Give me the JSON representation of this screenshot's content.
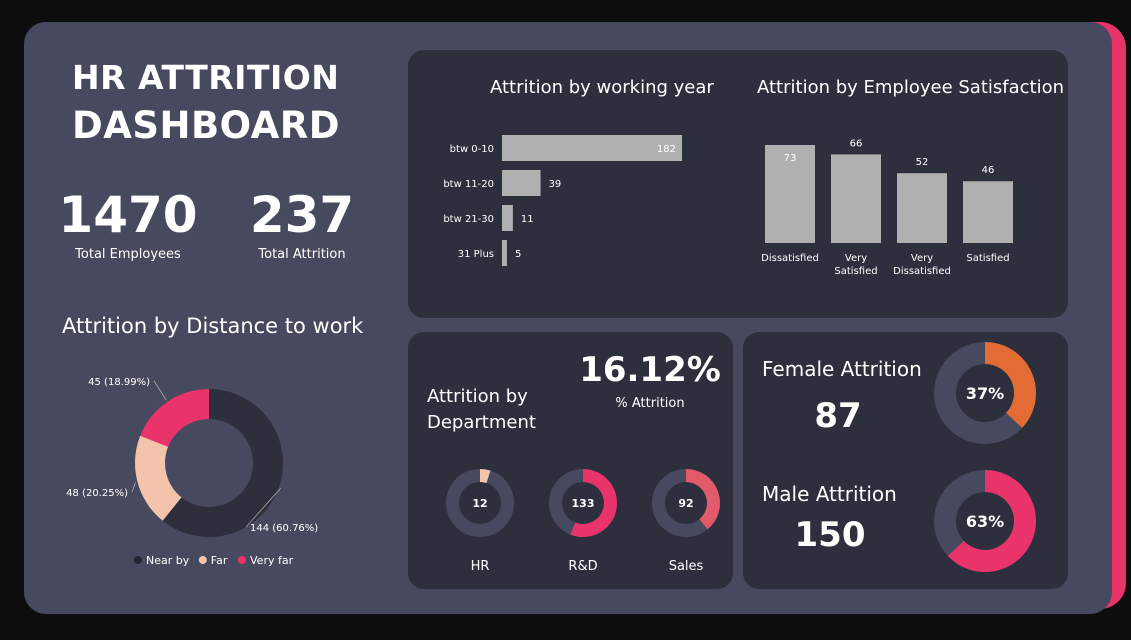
{
  "header": {
    "title_line1": "HR ATTRITION",
    "title_line2": "DASHBOARD"
  },
  "kpis": {
    "total_employees": {
      "value": "1470",
      "label": "Total Employees"
    },
    "total_attrition": {
      "value": "237",
      "label": "Total Attrition"
    }
  },
  "colors": {
    "accent": "#e8336b",
    "panel": "#474a5e",
    "card": "#2e2f3d",
    "bar": "#b0b0b0",
    "near": "#2e2f3d",
    "far": "#f4c3ac",
    "very_far": "#e8336b",
    "female": "#e36c35",
    "track": "#474a5e"
  },
  "department": {
    "title_line1": "Attrition by",
    "title_line2": "Department",
    "percent_value": "16.12%",
    "percent_label": "% Attrition"
  },
  "gender": {
    "female_label": "Female Attrition",
    "female_value": "87",
    "female_pct": "37%",
    "male_label": "Male Attrition",
    "male_value": "150",
    "male_pct": "63%"
  },
  "chart_data": [
    {
      "id": "working_year",
      "type": "bar",
      "orientation": "horizontal",
      "title": "Attrition by working year",
      "categories": [
        "btw 0-10",
        "btw 11-20",
        "btw 21-30",
        "31 Plus"
      ],
      "values": [
        182,
        39,
        11,
        5
      ],
      "data_labels": [
        "182",
        "39",
        "11",
        "5"
      ],
      "xlim": [
        0,
        182
      ]
    },
    {
      "id": "satisfaction",
      "type": "bar",
      "title": "Attrition by Employee Satisfaction",
      "categories": [
        "Dissatisfied",
        "Very Satisfied",
        "Very Dissatisfied",
        "Satisfied"
      ],
      "category_lines": [
        [
          "Dissatisfied"
        ],
        [
          "Very",
          "Satisfied"
        ],
        [
          "Very",
          "Dissatisfied"
        ],
        [
          "Satisfied"
        ]
      ],
      "values": [
        73,
        66,
        52,
        46
      ],
      "data_labels": [
        "73",
        "66",
        "52",
        "46"
      ],
      "ylim": [
        0,
        73
      ]
    },
    {
      "id": "distance",
      "type": "pie",
      "donut": true,
      "title": "Attrition by Distance to work",
      "categories": [
        "Near by",
        "Far",
        "Very far"
      ],
      "values": [
        144,
        48,
        45
      ],
      "percents": [
        60.76,
        20.25,
        18.99
      ],
      "data_labels": [
        "144 (60.76%)",
        "48 (20.25%)",
        "45 (18.99%)"
      ],
      "legend": [
        "Near by",
        "Far",
        "Very far"
      ],
      "legend_position": "bottom"
    },
    {
      "id": "department_donuts",
      "type": "pie",
      "donut": true,
      "categories": [
        "HR",
        "R&D",
        "Sales"
      ],
      "values": [
        12,
        133,
        92
      ],
      "fractions": [
        0.05,
        0.56,
        0.39
      ],
      "data_labels": [
        "12",
        "133",
        "92"
      ],
      "colors": [
        "#f4c3ac",
        "#e8336b",
        "#e35a6a"
      ]
    },
    {
      "id": "gender_donuts",
      "type": "pie",
      "donut": true,
      "categories": [
        "Female",
        "Male"
      ],
      "values": [
        87,
        150
      ],
      "percents": [
        37,
        63
      ],
      "data_labels": [
        "37%",
        "63%"
      ]
    }
  ]
}
